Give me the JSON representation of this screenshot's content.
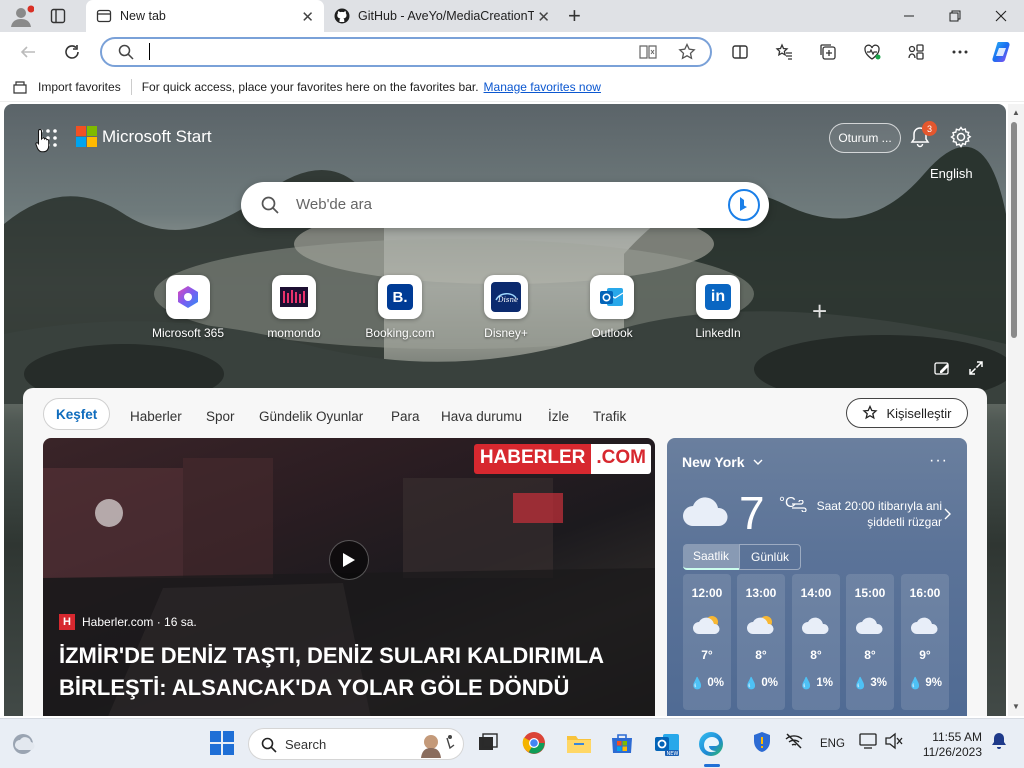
{
  "browser": {
    "tabs": [
      {
        "title": "New tab",
        "active": true
      },
      {
        "title": "GitHub - AveYo/MediaCreationT",
        "active": false
      }
    ],
    "address": {
      "value": "",
      "placeholder": ""
    }
  },
  "favorites_bar": {
    "import_label": "Import favorites",
    "message": "For quick access, place your favorites here on the favorites bar.",
    "manage_link": "Manage favorites now"
  },
  "start": {
    "brand": "Microsoft Start",
    "signin": "Oturum ...",
    "notifications_count": "3",
    "language": "English",
    "search_placeholder": "Web'de ara",
    "quick_links": [
      {
        "label": "Microsoft 365",
        "icon": "microsoft365-icon"
      },
      {
        "label": "momondo",
        "icon": "momondo-icon"
      },
      {
        "label": "Booking.com",
        "icon": "booking-icon"
      },
      {
        "label": "Disney+",
        "icon": "disney-plus-icon"
      },
      {
        "label": "Outlook",
        "icon": "outlook-icon"
      },
      {
        "label": "LinkedIn",
        "icon": "linkedin-icon"
      }
    ]
  },
  "feed": {
    "tabs": [
      "Keşfet",
      "Haberler",
      "Spor",
      "Gündelik Oyunlar",
      "Para",
      "Hava durumu",
      "İzle",
      "Trafik"
    ],
    "personalize": "Kişiselleştir",
    "news": {
      "logo_left": "HABERLER",
      "logo_right": ".COM",
      "source": "Haberler.com · 16 sa.",
      "title_line1": "İZMİR'DE DENİZ TAŞTI, DENİZ SULARI KALDIRIMLA",
      "title_line2": "BİRLEŞTİ: ALSANCAK'DA YOLAR GÖLE DÖNDÜ"
    },
    "weather": {
      "city": "New York",
      "temp": "7",
      "unit": "°C",
      "desc": "Saat 20:00 itibarıyla ani şiddetli rüzgar",
      "tab_hourly": "Saatlik",
      "tab_daily": "Günlük",
      "hours": [
        {
          "time": "12:00",
          "temp": "7°",
          "precip": "0%",
          "icon": "partly-cloudy-icon"
        },
        {
          "time": "13:00",
          "temp": "8°",
          "precip": "0%",
          "icon": "partly-cloudy-icon"
        },
        {
          "time": "14:00",
          "temp": "8°",
          "precip": "1%",
          "icon": "cloudy-icon"
        },
        {
          "time": "15:00",
          "temp": "8°",
          "precip": "3%",
          "icon": "cloudy-icon"
        },
        {
          "time": "16:00",
          "temp": "9°",
          "precip": "9%",
          "icon": "cloudy-icon"
        }
      ]
    }
  },
  "taskbar": {
    "search_label": "Search",
    "lang": "ENG",
    "time": "11:55 AM",
    "date": "11/26/2023"
  }
}
